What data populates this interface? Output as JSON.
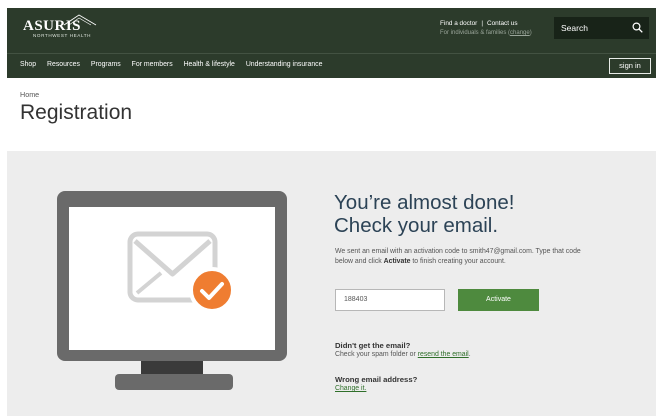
{
  "header": {
    "logo_word": "ASURIS",
    "logo_sub": "NORTHWEST HEALTH",
    "find_doctor": "Find a doctor",
    "separator": "|",
    "contact_us": "Contact us",
    "audience_text": "For individuals & families",
    "audience_open": "(",
    "audience_link": "change",
    "audience_close": ")",
    "search_placeholder": "Search"
  },
  "nav": {
    "items": [
      "Shop",
      "Resources",
      "Programs",
      "For members",
      "Health & lifestyle",
      "Understanding insurance"
    ],
    "signin": "sign in"
  },
  "breadcrumb": "Home",
  "page_title": "Registration",
  "confirmation": {
    "headline_line1": "You’re almost done!",
    "headline_line2": "Check your email.",
    "message_part1": "We sent an email with an activation code to smith47@gmail.com. Type that code below and click",
    "message_bold": "Activate",
    "message_part2": "to finish creating your account.",
    "code_value": "188403",
    "activate_label": "Activate",
    "no_email_title": "Didn't get the email?",
    "no_email_text": "Check your spam folder or",
    "resend_link": "resend the email",
    "period": ".",
    "wrong_email_title": "Wrong email address?",
    "change_link": "Change it."
  },
  "icons": {
    "search": "search-icon",
    "monitor": "monitor-illustration",
    "envelope": "envelope-icon",
    "check": "checkmark-badge-icon"
  },
  "colors": {
    "header_bg": "#2c3b2b",
    "accent_green": "#4e8a3e",
    "check_orange": "#ef7d31",
    "headline_blue": "#2c4356"
  }
}
